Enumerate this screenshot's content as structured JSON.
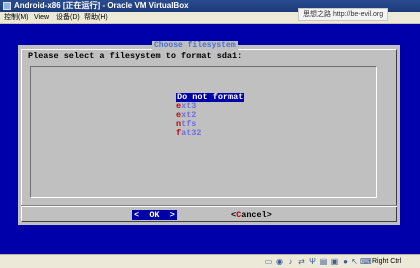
{
  "window": {
    "title": "Android-x86 [正在运行] - Oracle VM VirtualBox"
  },
  "watermark": "思想之路 http://be-evil.org",
  "menubar": {
    "items": [
      "控制(M)",
      "View",
      "设备(D)",
      "帮助(H)"
    ]
  },
  "dialog": {
    "title": "Choose filesystem",
    "prompt": "Please select a filesystem to format sda1:",
    "options": [
      {
        "hotkey": "D",
        "rest": "o not format",
        "selected": true
      },
      {
        "hotkey": "e",
        "rest": "xt3",
        "selected": false
      },
      {
        "hotkey": "e",
        "rest": "xt2",
        "selected": false
      },
      {
        "hotkey": "n",
        "rest": "tfs",
        "selected": false
      },
      {
        "hotkey": "f",
        "rest": "at32",
        "selected": false
      }
    ],
    "ok": {
      "lt": "<",
      "label": "OK",
      "gt": ">"
    },
    "cancel": {
      "lt": "<",
      "hotkey": "C",
      "rest": "ancel",
      "gt": ">"
    }
  },
  "statusbar": {
    "icons": [
      "hard-disk-icon",
      "optical-drive-icon",
      "audio-icon",
      "network-icon",
      "usb-icon",
      "shared-folder-icon",
      "display-icon",
      "recording-icon",
      "mouse-integration-icon",
      "keyboard-icon"
    ],
    "host_key": "Right Ctrl"
  },
  "colors": {
    "vm_background": "#0000aa",
    "dialog": "#c0c0c0",
    "selection": "#0000a8",
    "hotkey": "#c00000",
    "option_text": "#6f6fdc"
  }
}
